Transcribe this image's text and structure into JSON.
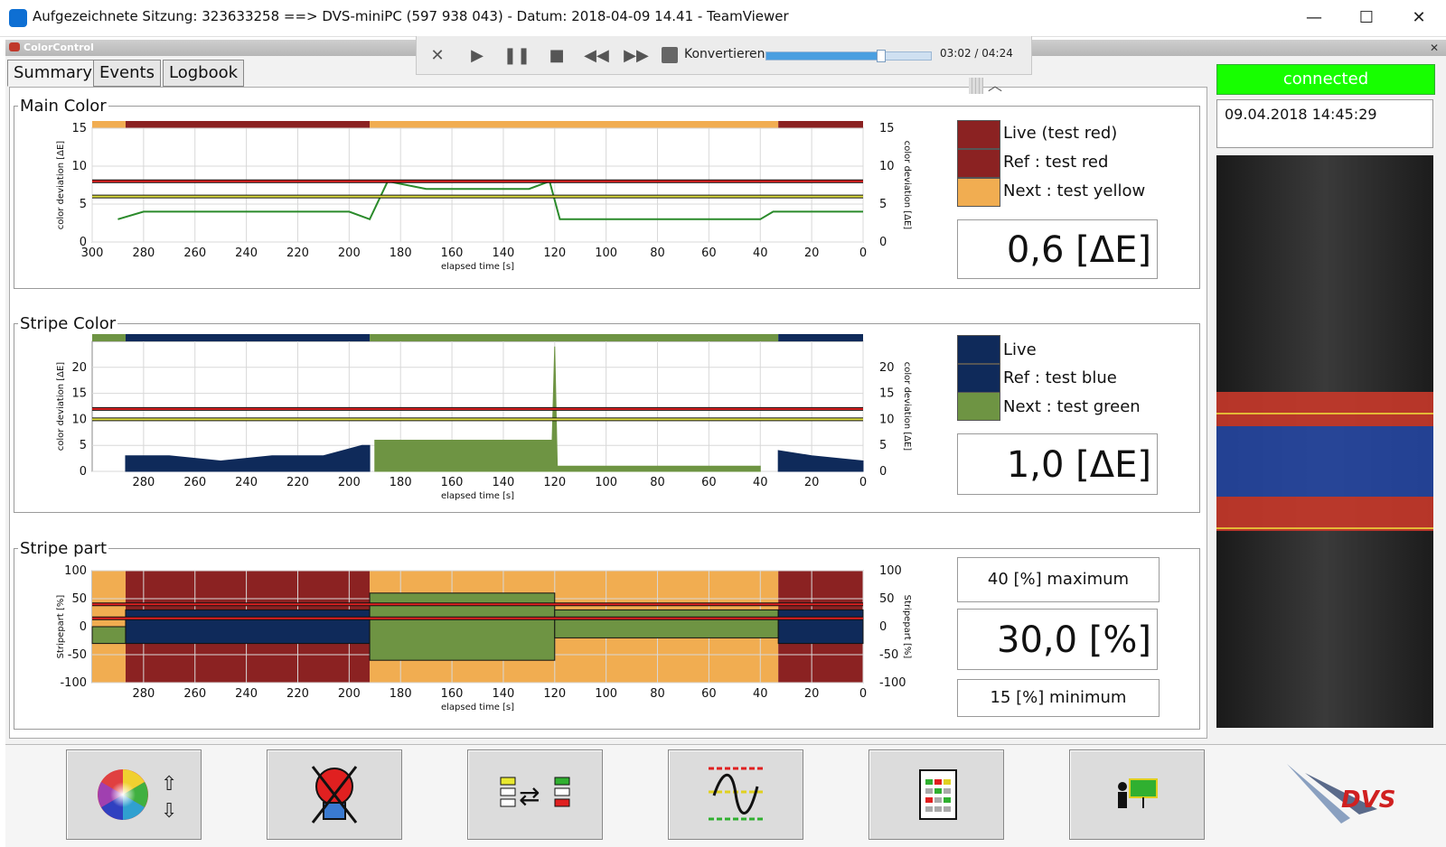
{
  "window": {
    "title": "Aufgezeichnete Sitzung: 323633258 ==> DVS-miniPC (597 938 043) - Datum: 2018-04-09 14.41 - TeamViewer",
    "minimize": "—",
    "maximize": "☐",
    "close": "✕"
  },
  "app": {
    "title": "ColorControl",
    "close": "✕"
  },
  "tabs": [
    {
      "label": "Summary"
    },
    {
      "label": "Events"
    },
    {
      "label": "Logbook"
    }
  ],
  "player": {
    "convert_label": "Konvertieren",
    "time": "03:02 / 04:24",
    "progress": 0.69
  },
  "status": {
    "connection": "connected",
    "datetime": "09.04.2018 14:45:29"
  },
  "main_color": {
    "title": "Main Color",
    "legend": [
      {
        "label": "Live (test red)",
        "color": "#8b2222"
      },
      {
        "label": "Ref : test red",
        "color": "#8b2222"
      },
      {
        "label": "Next : test yellow",
        "color": "#f1ad51"
      }
    ],
    "value": "0,6 [ΔE]"
  },
  "stripe_color": {
    "title": "Stripe Color",
    "legend": [
      {
        "label": "Live",
        "color": "#0f2a5a"
      },
      {
        "label": "Ref : test blue",
        "color": "#0f2a5a"
      },
      {
        "label": "Next : test green",
        "color": "#6e9443"
      }
    ],
    "value": "1,0 [ΔE]"
  },
  "stripe_part": {
    "title": "Stripe part",
    "maximum": "40 [%] maximum",
    "value": "30,0 [%]",
    "minimum": "15 [%] minimum"
  },
  "chart_data": [
    {
      "type": "line",
      "title": "Main Color",
      "xlabel": "elapsed time [s]",
      "ylabel": "color deviation [ΔE]",
      "xlim": [
        300,
        0
      ],
      "ylim": [
        0,
        15
      ],
      "x_ticks": [
        300,
        280,
        260,
        240,
        220,
        200,
        180,
        160,
        140,
        120,
        100,
        80,
        60,
        40,
        20,
        0
      ],
      "y_ticks": [
        0,
        5,
        10,
        15
      ],
      "thresholds": [
        {
          "value": 8,
          "color": "#e02020"
        },
        {
          "value": 6,
          "color": "#e0e040"
        }
      ],
      "segments": [
        {
          "from": 300,
          "to": 287,
          "color": "#f1ad51"
        },
        {
          "from": 287,
          "to": 192,
          "color": "#8b2222"
        },
        {
          "from": 192,
          "to": 33,
          "color": "#f1ad51"
        },
        {
          "from": 33,
          "to": 0,
          "color": "#8b2222"
        }
      ],
      "series": [
        {
          "color": "#2a8a2a",
          "x": [
            290,
            280,
            260,
            240,
            220,
            200,
            192,
            185,
            170,
            160,
            150,
            140,
            130,
            122,
            118,
            100,
            80,
            60,
            40,
            35,
            20,
            0
          ],
          "y": [
            3,
            4,
            4,
            4,
            4,
            4,
            3,
            8,
            7,
            7,
            7,
            7,
            7,
            8,
            3,
            3,
            3,
            3,
            3,
            4,
            4,
            4
          ]
        }
      ]
    },
    {
      "type": "area",
      "title": "Stripe Color",
      "xlabel": "elapsed time [s]",
      "ylabel": "color deviation [ΔE]",
      "xlim": [
        300,
        0
      ],
      "ylim": [
        0,
        25
      ],
      "x_ticks": [
        280,
        260,
        240,
        220,
        200,
        180,
        160,
        140,
        120,
        100,
        80,
        60,
        40,
        20,
        0
      ],
      "y_ticks": [
        0,
        5,
        10,
        15,
        20
      ],
      "thresholds": [
        {
          "value": 12,
          "color": "#e02020"
        },
        {
          "value": 10,
          "color": "#e0e040"
        }
      ],
      "segments": [
        {
          "from": 300,
          "to": 287,
          "color": "#6e9443"
        },
        {
          "from": 287,
          "to": 192,
          "color": "#0f2a5a"
        },
        {
          "from": 192,
          "to": 33,
          "color": "#6e9443"
        },
        {
          "from": 33,
          "to": 0,
          "color": "#0f2a5a"
        }
      ],
      "series": [
        {
          "color": "#0f2a5a",
          "x": [
            287,
            270,
            250,
            230,
            210,
            195,
            192
          ],
          "y": [
            3,
            3,
            2,
            3,
            3,
            5,
            5
          ]
        },
        {
          "color": "#6e9443",
          "x": [
            190,
            170,
            150,
            140,
            130,
            121,
            120,
            119,
            100,
            80,
            60,
            40
          ],
          "y": [
            6,
            6,
            6,
            6,
            6,
            6,
            24,
            1,
            1,
            1,
            1,
            1
          ]
        },
        {
          "color": "#0f2a5a",
          "x": [
            33,
            20,
            0
          ],
          "y": [
            4,
            3,
            2
          ]
        }
      ]
    },
    {
      "type": "area",
      "title": "Stripe part",
      "xlabel": "elapsed time [s]",
      "ylabel": "Stripepart [%]",
      "xlim": [
        300,
        0
      ],
      "ylim": [
        -100,
        100
      ],
      "x_ticks": [
        280,
        260,
        240,
        220,
        200,
        180,
        160,
        140,
        120,
        100,
        80,
        60,
        40,
        20,
        0
      ],
      "y_ticks": [
        -100,
        -50,
        0,
        50,
        100
      ],
      "thresholds": [
        {
          "value": 40,
          "color": "#e02020"
        },
        {
          "value": 15,
          "color": "#e02020"
        }
      ],
      "segments": [
        {
          "from": 300,
          "to": 287,
          "color": "#f1ad51"
        },
        {
          "from": 287,
          "to": 192,
          "color": "#8b2222"
        },
        {
          "from": 192,
          "to": 120,
          "color": "#f1ad51"
        },
        {
          "from": 120,
          "to": 33,
          "color": "#f1ad51"
        },
        {
          "from": 33,
          "to": 0,
          "color": "#8b2222"
        }
      ],
      "bands": [
        {
          "from": 300,
          "to": 287,
          "upper": 0,
          "lower": -30,
          "color": "#6e9443"
        },
        {
          "from": 287,
          "to": 192,
          "upper": 30,
          "lower": -30,
          "color": "#0f2a5a"
        },
        {
          "from": 192,
          "to": 120,
          "upper": 60,
          "lower": -60,
          "color": "#6e9443"
        },
        {
          "from": 120,
          "to": 33,
          "upper": 30,
          "lower": -20,
          "color": "#6e9443"
        },
        {
          "from": 33,
          "to": 0,
          "upper": 30,
          "lower": -30,
          "color": "#0f2a5a"
        }
      ]
    }
  ]
}
